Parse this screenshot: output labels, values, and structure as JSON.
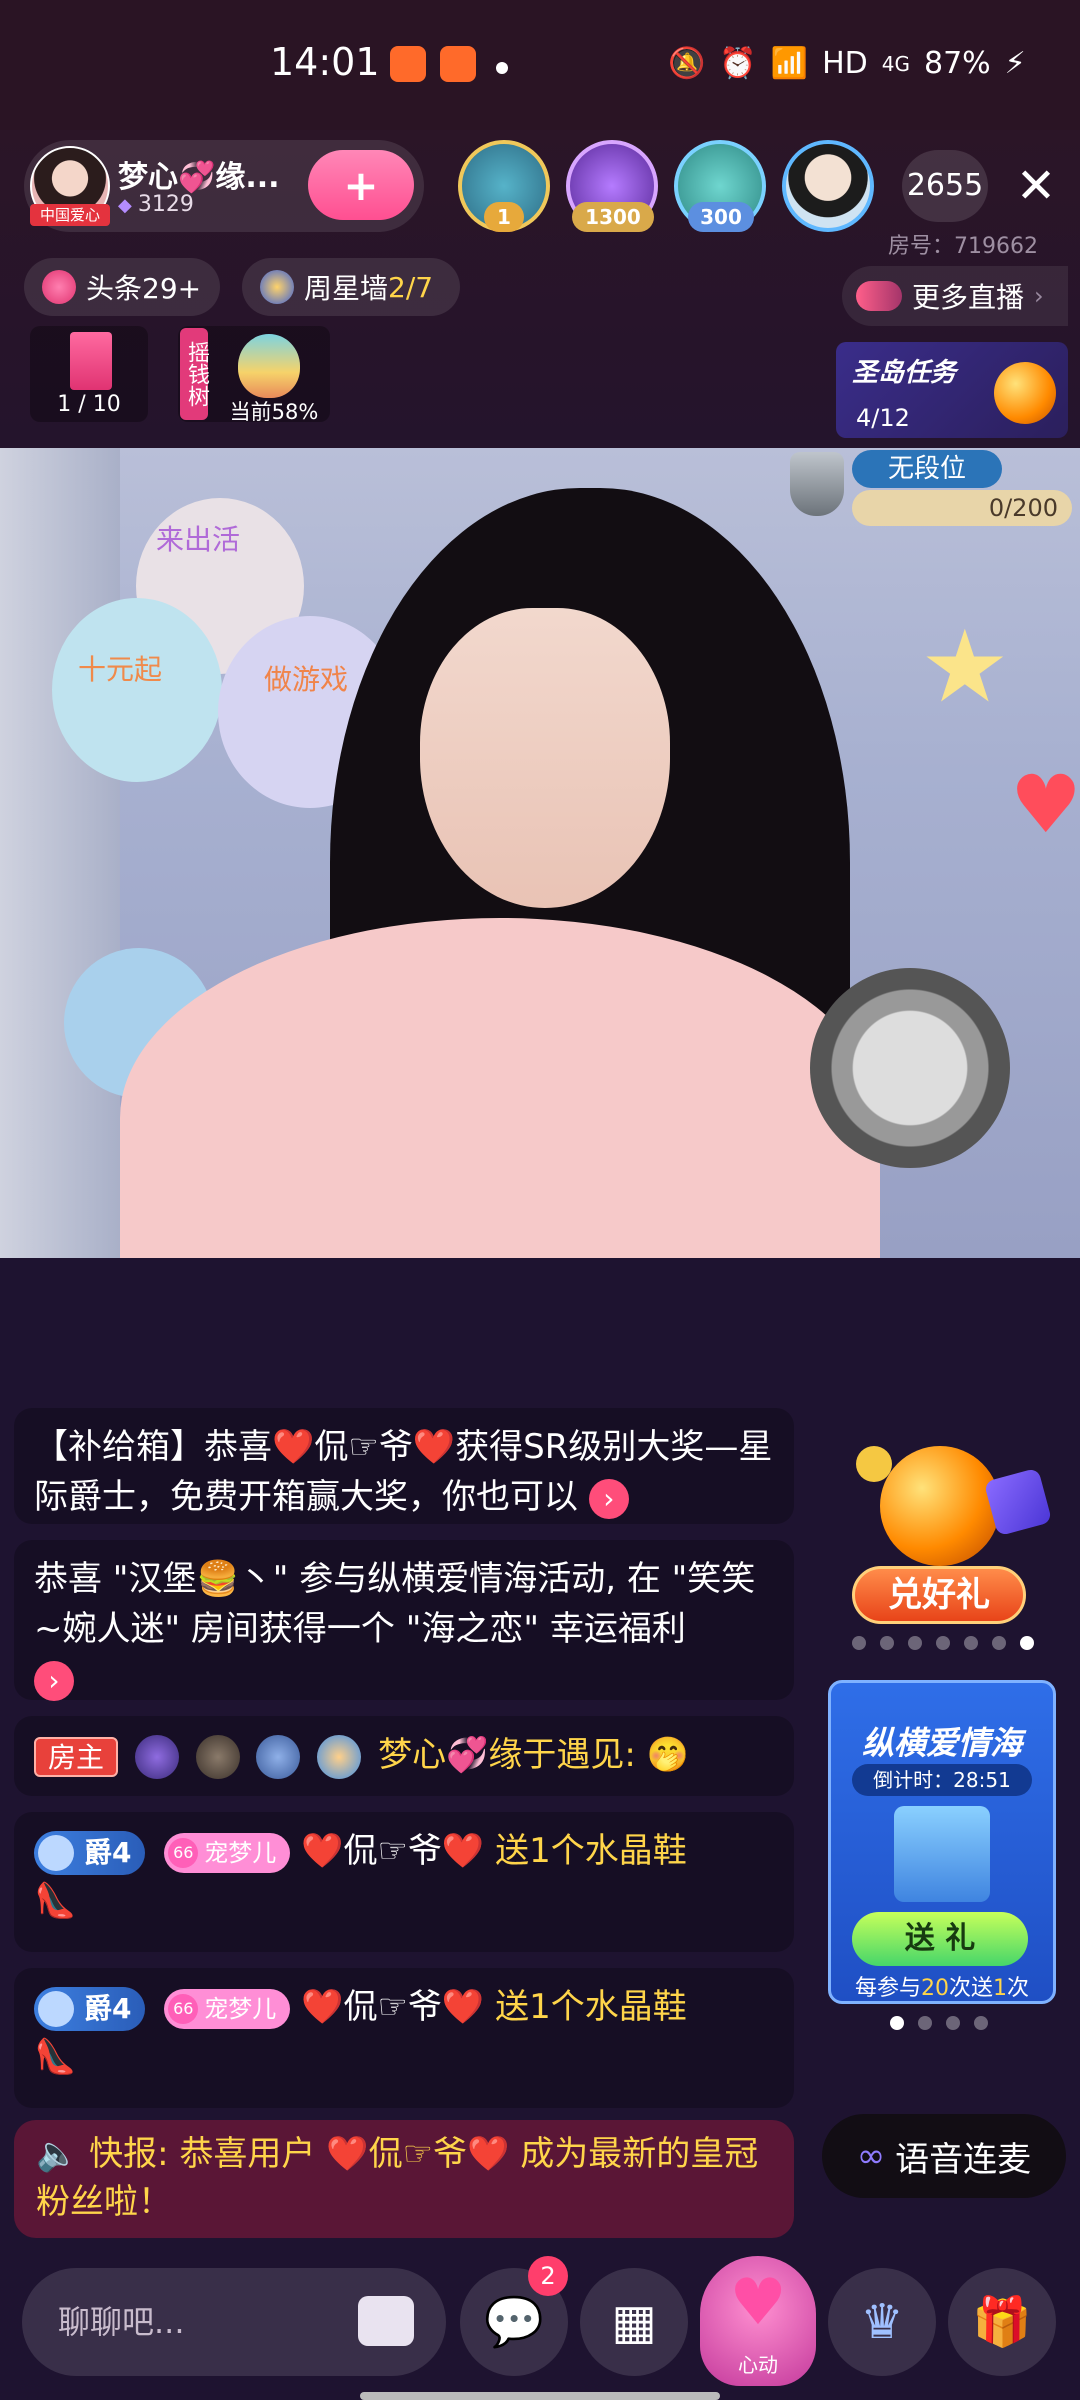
{
  "status_bar": {
    "time": "14:01",
    "network": "HD",
    "signal": "4G",
    "battery": "87%"
  },
  "header": {
    "host_name": "梦心💞缘...",
    "host_badge": "中国爱心",
    "host_fans": "3129",
    "top_viewer_badges": [
      "1",
      "1300",
      "300"
    ],
    "viewer_count": "2655",
    "room_no": "房号：719662",
    "headline_pill": "头条29+",
    "star_wall_label": "周星墙",
    "star_wall_progress": "2/7",
    "more_live": "更多直播",
    "card_progress": "1 / 10",
    "money_tree": "摇钱树",
    "egg_progress": "当前58%",
    "mission_title": "圣岛任务",
    "mission_progress": "4/12"
  },
  "video": {
    "balloon_1": "来出活",
    "balloon_2": "十元起",
    "balloon_3": "做游戏",
    "rank_label": "无段位",
    "rank_progress": "0/200"
  },
  "chat": {
    "msg1": "【补给箱】恭喜❤️侃☞爷❤️获得SR级别大奖—星际爵士，免费开箱赢大奖，你也可以",
    "msg2": "恭喜 \"汉堡🍔丶\" 参与纵横爱情海活动, 在 \"笑笑~婉人迷\" 房间获得一个 \"海之恋\" 幸运福利",
    "owner_tag": "房主",
    "owner_name": "梦心💞缘于遇见:",
    "owner_emoji": "🤭",
    "noble_level": "爵4",
    "fan_club": "宠梦儿",
    "fan_level": "66",
    "sender": "❤️侃☞爷❤️",
    "gift_text": "送1个水晶鞋",
    "gift_icon": "👠",
    "flash_label": "快报:",
    "flash_text": "恭喜用户 ❤️侃☞爷❤️ 成为最新的皇冠粉丝啦！"
  },
  "side": {
    "redeem": "兑好礼",
    "event_title": "纵横爱情海",
    "countdown": "倒计时：28:51",
    "send_gift": "送 礼",
    "event_note_a": "每参与",
    "event_note_num": "20",
    "event_note_b": "次送",
    "event_note_num2": "1",
    "event_note_c": "次",
    "voice_link": "语音连麦"
  },
  "bottom": {
    "input_placeholder": "聊聊吧...",
    "msg_badge": "2",
    "heart_label": "心动"
  },
  "icons": {
    "accent": "#ff4f91",
    "highlight": "#ffd54a"
  }
}
